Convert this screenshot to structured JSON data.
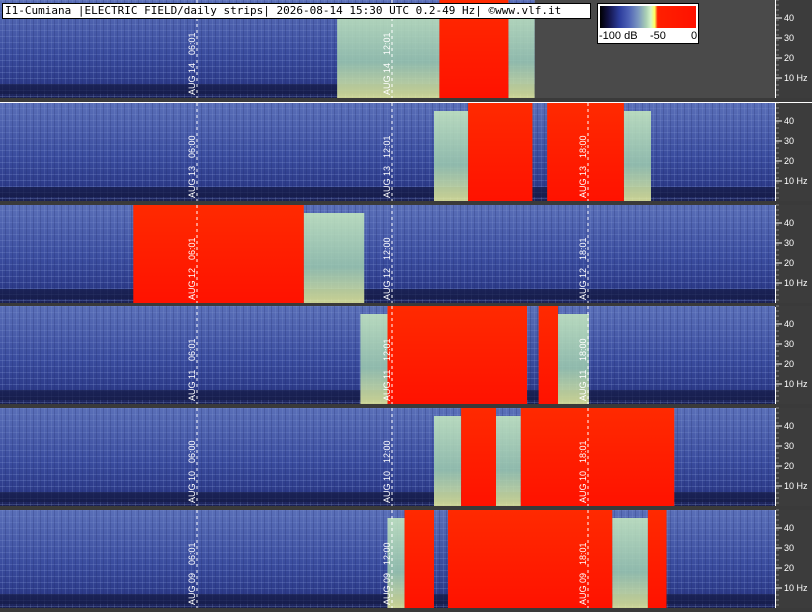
{
  "title": "I1-Cumiana |ELECTRIC FIELD/daily strips| 2026-08-14 15:30 UTC 0.2-49 Hz| ©www.vlf.it",
  "legend": {
    "labels": [
      "-100 dB",
      "-50",
      "0"
    ]
  },
  "axis_labels": [
    "40",
    "30",
    "20",
    "10 Hz"
  ],
  "colors": {
    "background_low": "#2f3f8f",
    "signal_high": "#ff2200",
    "mid_green": "#a8d6b0",
    "empty_area": "#4a4a4a"
  },
  "strips": [
    {
      "name": "strip-aug-14",
      "ticks": [
        {
          "time": "06:01",
          "date": "AUG 14"
        },
        {
          "time": "12:01",
          "date": "AUG 14"
        }
      ],
      "red_segments": [
        [
          0.567,
          0.656
        ]
      ],
      "green_segments": [
        [
          0.435,
          0.567
        ],
        [
          0.656,
          0.69
        ]
      ],
      "empty_after": 0.69
    },
    {
      "name": "strip-aug-13",
      "ticks": [
        {
          "time": "06:00",
          "date": "AUG 13"
        },
        {
          "time": "12:01",
          "date": "AUG 13"
        },
        {
          "time": "18:00",
          "date": "AUG 13"
        }
      ],
      "red_segments": [
        [
          0.604,
          0.687
        ],
        [
          0.706,
          0.805
        ]
      ],
      "green_segments": [
        [
          0.56,
          0.604
        ],
        [
          0.805,
          0.84
        ]
      ],
      "empty_after": null
    },
    {
      "name": "strip-aug-12",
      "ticks": [
        {
          "time": "06:01",
          "date": "AUG 12"
        },
        {
          "time": "12:00",
          "date": "AUG 12"
        },
        {
          "time": "18:01",
          "date": "AUG 12"
        }
      ],
      "red_segments": [
        [
          0.172,
          0.392
        ]
      ],
      "green_segments": [
        [
          0.392,
          0.47
        ]
      ],
      "empty_after": null
    },
    {
      "name": "strip-aug-11",
      "ticks": [
        {
          "time": "06:01",
          "date": "AUG 11"
        },
        {
          "time": "12:01",
          "date": "AUG 11"
        },
        {
          "time": "18:00",
          "date": "AUG 11"
        }
      ],
      "red_segments": [
        [
          0.5,
          0.68
        ],
        [
          0.695,
          0.72
        ]
      ],
      "green_segments": [
        [
          0.465,
          0.5
        ],
        [
          0.72,
          0.76
        ]
      ],
      "empty_after": null
    },
    {
      "name": "strip-aug-10",
      "ticks": [
        {
          "time": "06:00",
          "date": "AUG 10"
        },
        {
          "time": "12:00",
          "date": "AUG 10"
        },
        {
          "time": "18:01",
          "date": "AUG 10"
        }
      ],
      "red_segments": [
        [
          0.595,
          0.64
        ],
        [
          0.672,
          0.87
        ]
      ],
      "green_segments": [
        [
          0.56,
          0.595
        ],
        [
          0.64,
          0.672
        ]
      ],
      "empty_after": null
    },
    {
      "name": "strip-aug-09",
      "ticks": [
        {
          "time": "06:01",
          "date": "AUG 09"
        },
        {
          "time": "12:00",
          "date": "AUG 09"
        },
        {
          "time": "18:01",
          "date": "AUG 09"
        }
      ],
      "red_segments": [
        [
          0.522,
          0.56
        ],
        [
          0.578,
          0.79
        ],
        [
          0.836,
          0.86
        ]
      ],
      "green_segments": [
        [
          0.5,
          0.522
        ],
        [
          0.79,
          0.836
        ]
      ],
      "empty_after": null
    }
  ]
}
